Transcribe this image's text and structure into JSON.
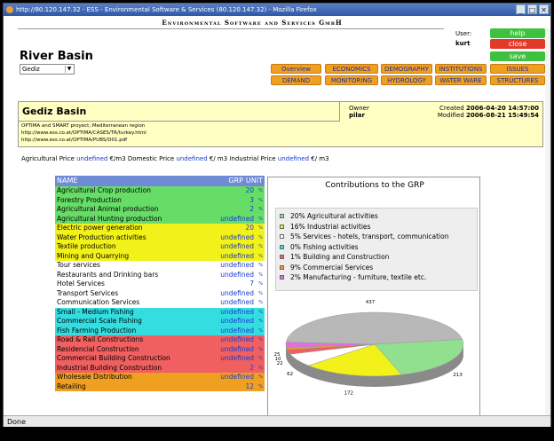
{
  "window": {
    "title": "http://80.120.147.32 - ESS - Environmental Software & Services (80.120.147.32) - Mozilla Firefox",
    "status": "Done"
  },
  "header": {
    "company": "Environmental Software and Services GmbH",
    "page_title": "River Basin",
    "user_label": "User:",
    "user_name": "kurt",
    "basin_select": "Gediz",
    "help": "help",
    "close": "close",
    "save": "save"
  },
  "nav": {
    "row1": [
      "Overview",
      "ECONOMICS",
      "DEMOGRAPHY",
      "INSTITUTIONS",
      "ISSUES"
    ],
    "row2": [
      "DEMAND",
      "MONITORING",
      "HYDROLOGY",
      "WATER WARE",
      "STRUCTURES"
    ]
  },
  "basin": {
    "title": "Gediz Basin",
    "owner_label": "Owner",
    "owner": "pilar",
    "created_label": "Created",
    "created": "2006-04-20 14:57:00",
    "modified_label": "Modified",
    "modified": "2006-08-21 15:49:54",
    "description": [
      "OPTIMA and SMART proyect, Mediterranean region",
      "http://www.ess.co.at/OPTIMA/CASES/TR/turkey.html",
      "http://www.ess.co.at/OPTIMA/PUBS/D01.pdf"
    ]
  },
  "prices": {
    "agri_label": "Agricultural Price",
    "agri_value": "undefined",
    "agri_unit": "€/m3",
    "dom_label": "Domestic Price",
    "dom_value": "undefined",
    "dom_unit": "€/ m3",
    "ind_label": "Industrial Price",
    "ind_value": "undefined",
    "ind_unit": "€/ m3"
  },
  "table": {
    "col_name": "NAME",
    "col_grp": "GRP",
    "col_unit": "UNIT",
    "rows": [
      {
        "name": "Agricultural Crop production",
        "value": "20",
        "unit": "%",
        "color": "#66dd66"
      },
      {
        "name": "Forestry Production",
        "value": "3",
        "unit": "%",
        "color": "#66dd66"
      },
      {
        "name": "Agricultural Animal production",
        "value": "2",
        "unit": "%",
        "color": "#66dd66"
      },
      {
        "name": "Agricultural Hunting production",
        "value": "undefined",
        "unit": "%",
        "color": "#66dd66"
      },
      {
        "name": "Electric power generation",
        "value": "20",
        "unit": "%",
        "color": "#f2f21a"
      },
      {
        "name": "Water Production activities",
        "value": "undefined",
        "unit": "%",
        "color": "#f2f21a"
      },
      {
        "name": "Textile production",
        "value": "undefined",
        "unit": "%",
        "color": "#f2f21a"
      },
      {
        "name": "Mining and Quarrying",
        "value": "undefined",
        "unit": "%",
        "color": "#f2f21a"
      },
      {
        "name": "Tour services",
        "value": "undefined",
        "unit": "%",
        "color": "#ffffff"
      },
      {
        "name": "Restaurants and Drinking bars",
        "value": "undefined",
        "unit": "%",
        "color": "#ffffff"
      },
      {
        "name": "Hotel Services",
        "value": "7",
        "unit": "%",
        "color": "#ffffff"
      },
      {
        "name": "Transport Services",
        "value": "undefined",
        "unit": "%",
        "color": "#ffffff"
      },
      {
        "name": "Communication Services",
        "value": "undefined",
        "unit": "%",
        "color": "#ffffff"
      },
      {
        "name": "Small - Medium Fishing",
        "value": "undefined",
        "unit": "%",
        "color": "#33dde0"
      },
      {
        "name": "Commercial Scale Fishing",
        "value": "undefined",
        "unit": "%",
        "color": "#33dde0"
      },
      {
        "name": "Fish Farming Production",
        "value": "undefined",
        "unit": "%",
        "color": "#33dde0"
      },
      {
        "name": "Road & Rail Constructions",
        "value": "undefined",
        "unit": "%",
        "color": "#f06060"
      },
      {
        "name": "Residencial Construction",
        "value": "undefined",
        "unit": "%",
        "color": "#f06060"
      },
      {
        "name": "Commercial Building Construction",
        "value": "undefined",
        "unit": "%",
        "color": "#f06060"
      },
      {
        "name": "Industrial Building Construction",
        "value": "2",
        "unit": "%",
        "color": "#f06060"
      },
      {
        "name": "Wholesale Distribution",
        "value": "undefined",
        "unit": "%",
        "color": "#f0a020"
      },
      {
        "name": "Retailing",
        "value": "12",
        "unit": "%",
        "color": "#f0a020"
      }
    ]
  },
  "chart_data": {
    "type": "pie",
    "title": "Contributions to the GRP",
    "legend": [
      "20% Agricultural activities",
      "16% Industrial activities",
      "5% Services - hotels, transport, communication",
      "0% Fishing activities",
      "1% Building and Construction",
      "9% Commercial Services",
      "2% Manufacturing - furniture, textile etc."
    ],
    "categories": [
      "Agricultural activities",
      "Industrial activities",
      "Services - hotels, transport, communication",
      "Fishing activities",
      "Building and Construction",
      "Commercial Services",
      "Manufacturing - furniture, textile etc."
    ],
    "values": [
      20,
      16,
      5,
      0,
      1,
      9,
      2
    ],
    "slice_labels": [
      {
        "text": "213",
        "color": "#90e090"
      },
      {
        "text": "172",
        "color": "#f2f21a"
      },
      {
        "text": "62",
        "color": "#ffffff"
      },
      {
        "text": "22",
        "color": "#f06060"
      },
      {
        "text": "10",
        "color": "#f0a020"
      },
      {
        "text": "25",
        "color": "#e070e0"
      },
      {
        "text": "437",
        "color": "#b8b8b8"
      }
    ],
    "colors": [
      "#90e090",
      "#f2f21a",
      "#ffffff",
      "#33dde0",
      "#f06060",
      "#f0a020",
      "#e070e0"
    ]
  }
}
